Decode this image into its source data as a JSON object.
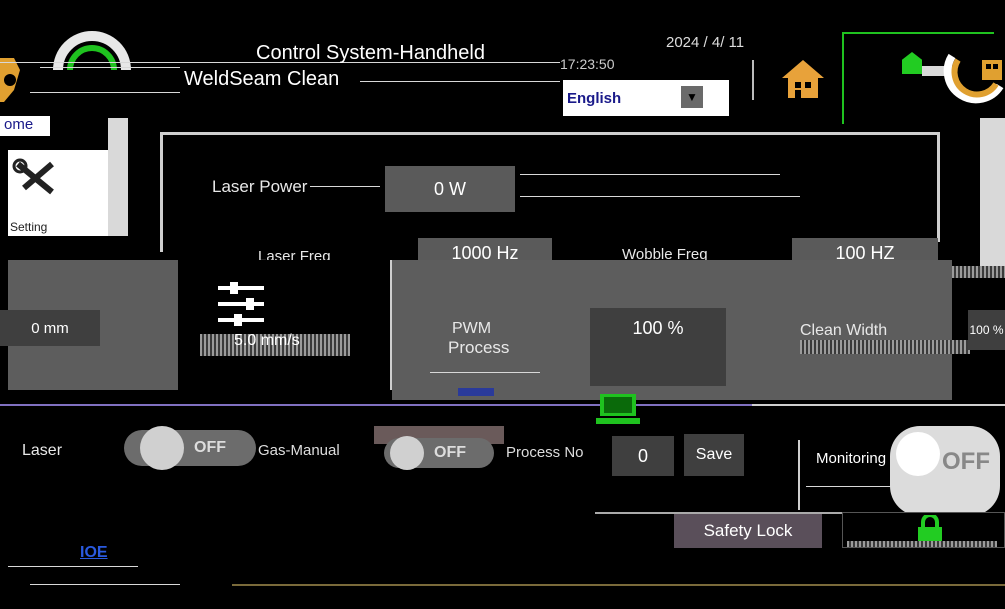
{
  "header": {
    "title_line1": "Control System-Handheld",
    "title_line2": "WeldSeam Clean",
    "date": "2024 /  4/   11",
    "time": "17:23:50",
    "language": "English",
    "home_tab": "ome"
  },
  "sidebar": {
    "settings_label": "Setting"
  },
  "params": {
    "laser_power_label": "Laser Power",
    "laser_power_value": "0 W",
    "laser_freq_label": "Laser Freq",
    "laser_freq_value": "1000 Hz",
    "wobble_freq_label": "Wobble Freq",
    "wobble_freq_value": "100 HZ",
    "wobble_width_value": "0 mm",
    "speed_value": "5.0 mm/s",
    "pwm_label_line1": "PWM",
    "pwm_label_line2": "Process",
    "pwm_value": "100 %",
    "clean_width_label": "Clean Width",
    "clean_width_value": "100 %"
  },
  "controls": {
    "laser_label": "Laser",
    "laser_toggle": "OFF",
    "gas_label": "Gas-Manual",
    "gas_toggle": "OFF",
    "process_no_label": "Process No",
    "process_no_value": "0",
    "save_label": "Save",
    "monitoring_label": "Monitoring",
    "monitoring_toggle": "OFF",
    "safety_lock_label": "Safety Lock",
    "io_label": "IOE"
  },
  "colors": {
    "accent_green": "#1fc21f",
    "house_orange": "#e8a23a",
    "lock_green": "#22cc22",
    "panel_gray": "#5a5a5a"
  }
}
